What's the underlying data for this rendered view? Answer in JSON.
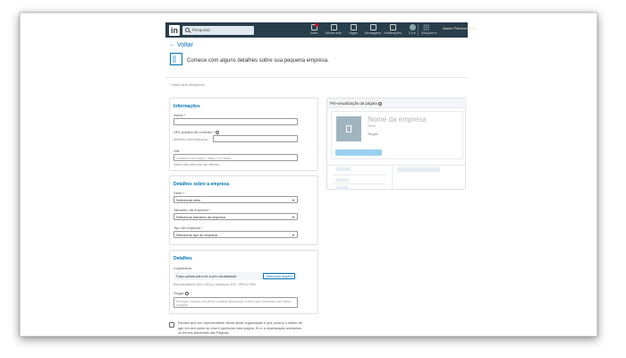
{
  "nav": {
    "logo": "in",
    "search_placeholder": "Pesquisar",
    "items": [
      {
        "label": "Início",
        "icon": "home-icon"
      },
      {
        "label": "Minha rede",
        "icon": "network-icon"
      },
      {
        "label": "Vagas",
        "icon": "briefcase-icon"
      },
      {
        "label": "Mensagens",
        "icon": "messages-icon"
      },
      {
        "label": "Notificações",
        "icon": "bell-icon"
      },
      {
        "label": "Eu ▾",
        "icon": "avatar"
      }
    ],
    "work_label": "Soluções ▾",
    "premium": "Assine Premium grátis"
  },
  "back_label": "Voltar",
  "intro": "Comece com alguns detalhes sobre sua pequena empresa.",
  "required_note": "* Indica item obrigatório",
  "info_section": {
    "title": "Informações",
    "name_label": "Nome *",
    "url_label": "URL pública do LinkedIn *",
    "url_prefix": "linkedin.com/company/",
    "site_label": "Site",
    "site_placeholder": "Comece com http://, https:// ou www.",
    "site_hint": "Saiba mais para criar seu sitemos"
  },
  "details_section": {
    "title": "Detalhes sobre a empresa",
    "sector_label": "Setor *",
    "sector_value": "Selecionar setor",
    "size_label": "Tamanho da empresa *",
    "size_value": "Selecionar tamanho da empresa",
    "type_label": "Tipo de empresa *",
    "type_value": "Selecionar tipo de empresa"
  },
  "extra_section": {
    "title": "Detalhes",
    "logo_label": "Logomarca",
    "logo_box_text": "Faça upload para ver a pré-visualização",
    "logo_button": "Selecionar arquivo",
    "logo_hint": "Recomendamos 300 x 300 px. Aceitamos JPG, JPEG e PNG.",
    "slogan_label": "Slogan",
    "slogan_placeholder": "Exemplo: Nossos escritório contábil ajuda local e além que empresas com ótimo cuidado"
  },
  "checkbox_text": "Declaro que sou representante oficial desta organização e que possuo o direito de agir em seu nome ao criar e gerenciar esta página. Eu e a organização aceitamos os termos adicionais das Páginas.",
  "preview": {
    "title": "Pré-visualização da página",
    "company_name": "Nome da empresa",
    "sector": "Setor",
    "slogan": "Slogan"
  }
}
